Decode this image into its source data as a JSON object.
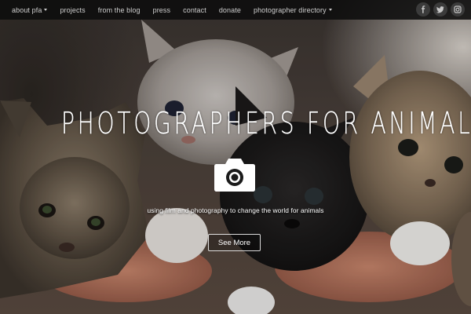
{
  "nav": {
    "items": [
      {
        "label": "about pfa",
        "dropdown": true
      },
      {
        "label": "projects",
        "dropdown": false
      },
      {
        "label": "from the blog",
        "dropdown": false
      },
      {
        "label": "press",
        "dropdown": false
      },
      {
        "label": "contact",
        "dropdown": false
      },
      {
        "label": "donate",
        "dropdown": false
      },
      {
        "label": "photographer directory",
        "dropdown": true
      }
    ],
    "social": [
      {
        "icon": "facebook-icon",
        "glyph": "f"
      },
      {
        "icon": "twitter-icon",
        "glyph": "t"
      },
      {
        "icon": "instagram-icon",
        "glyph": "◎"
      }
    ]
  },
  "hero": {
    "title": "PHOTOGRAPHERS FOR ANIMALS",
    "icon": "camera-icon",
    "tagline": "using film and photography to change the world for animals",
    "button_label": "See More"
  },
  "colors": {
    "navbar": "#0c0c0c",
    "text": "#ffffff",
    "nav_text": "#cfcfcf"
  }
}
